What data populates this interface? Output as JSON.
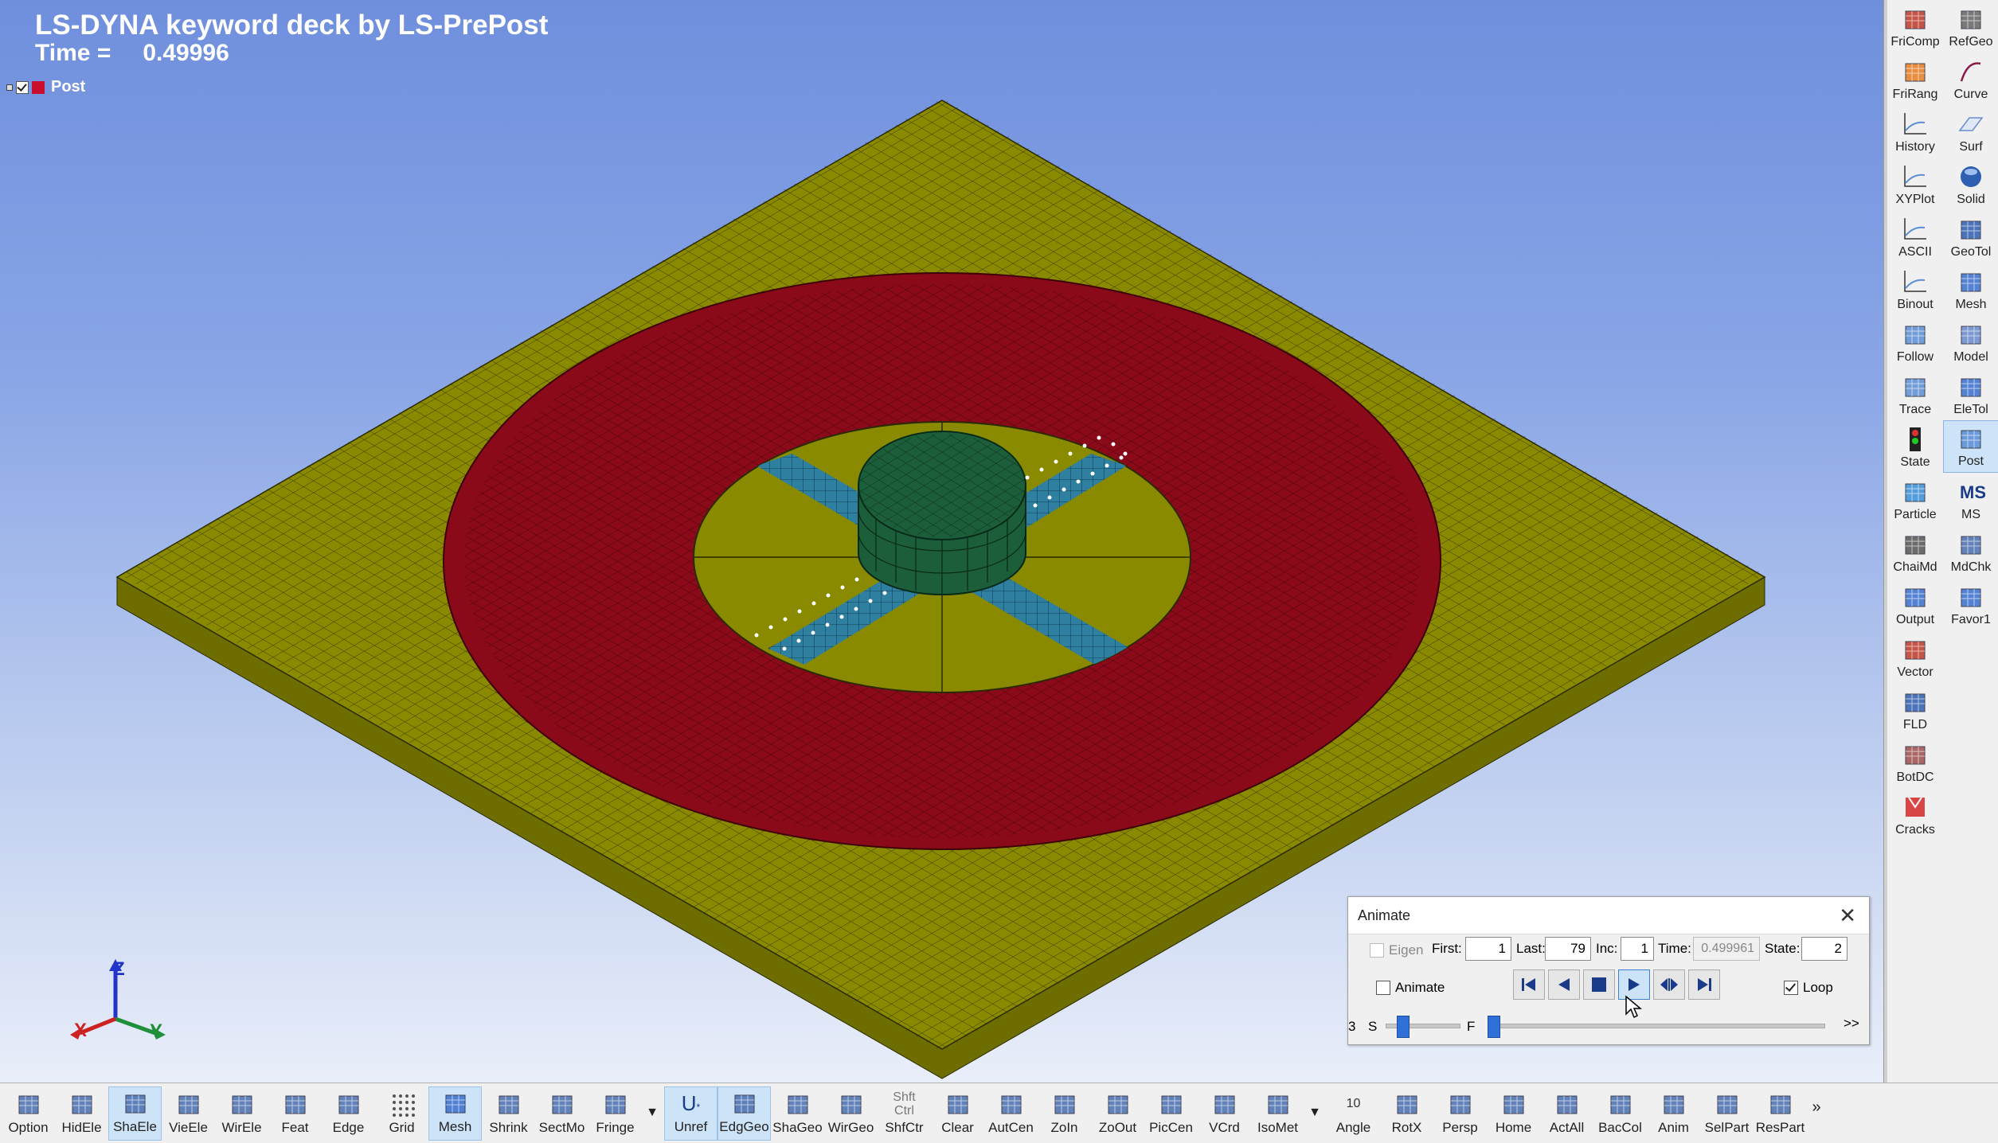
{
  "viewport": {
    "title": "LS-DYNA keyword deck by LS-PrePost",
    "time_label": "Time =",
    "time_value": "0.49996",
    "part_label": "Post",
    "axis": {
      "x": "X",
      "y": "Y",
      "z": "Z"
    }
  },
  "colors": {
    "plate": "#8a8a00",
    "ring": "#8b0a1a",
    "cylinder": "#1d5e3a",
    "strip": "#2f7fa0",
    "bg_top": "#6f8fdd",
    "bg_bottom": "#e9eef9",
    "accent": "#2e6fd8"
  },
  "right_panel": {
    "left": [
      {
        "label": "FriComp",
        "icon": "fricomp-icon"
      },
      {
        "label": "FriRang",
        "icon": "frirang-icon"
      },
      {
        "label": "History",
        "icon": "history-icon"
      },
      {
        "label": "XYPlot",
        "icon": "xyplot-icon"
      },
      {
        "label": "ASCII",
        "icon": "ascii-icon"
      },
      {
        "label": "Binout",
        "icon": "binout-icon"
      },
      {
        "label": "Follow",
        "icon": "follow-icon"
      },
      {
        "label": "Trace",
        "icon": "trace-icon"
      },
      {
        "label": "State",
        "icon": "state-icon"
      },
      {
        "label": "Particle",
        "icon": "particle-icon"
      },
      {
        "label": "ChaiMd",
        "icon": "chaimd-icon"
      },
      {
        "label": "Output",
        "icon": "output-icon"
      },
      {
        "label": "Vector",
        "icon": "vector-icon"
      },
      {
        "label": "FLD",
        "icon": "fld-icon"
      },
      {
        "label": "BotDC",
        "icon": "botdc-icon"
      },
      {
        "label": "Cracks",
        "icon": "cracks-icon"
      }
    ],
    "right": [
      {
        "label": "RefGeo",
        "icon": "refgeo-icon"
      },
      {
        "label": "Curve",
        "icon": "curve-icon"
      },
      {
        "label": "Surf",
        "icon": "surf-icon"
      },
      {
        "label": "Solid",
        "icon": "solid-icon"
      },
      {
        "label": "GeoTol",
        "icon": "geotol-icon"
      },
      {
        "label": "Mesh",
        "icon": "mesh-icon"
      },
      {
        "label": "Model",
        "icon": "model-icon"
      },
      {
        "label": "EleTol",
        "icon": "eletol-icon"
      },
      {
        "label": "Post",
        "icon": "post-icon"
      },
      {
        "label": "MS",
        "icon": "ms-icon"
      },
      {
        "label": "MdChk",
        "icon": "mdchk-icon"
      },
      {
        "label": "Favor1",
        "icon": "favor-icon"
      }
    ]
  },
  "bottom_toolbar": [
    {
      "label": "Option",
      "icon": "option-icon"
    },
    {
      "label": "HidEle",
      "icon": "hidele-icon"
    },
    {
      "label": "ShaEle",
      "icon": "shaele-icon"
    },
    {
      "label": "VieEle",
      "icon": "vieele-icon"
    },
    {
      "label": "WirEle",
      "icon": "wirele-icon"
    },
    {
      "label": "Feat",
      "icon": "feat-icon"
    },
    {
      "label": "Edge",
      "icon": "edge-icon"
    },
    {
      "label": "Grid",
      "icon": "grid-icon"
    },
    {
      "label": "Mesh",
      "icon": "mesh-icon"
    },
    {
      "label": "Shrink",
      "icon": "shrink-icon"
    },
    {
      "label": "SectMo",
      "icon": "sectmo-icon"
    },
    {
      "label": "Fringe",
      "icon": "fringe-icon"
    },
    {
      "label": "Unref",
      "icon": "unref-icon"
    },
    {
      "label": "EdgGeo",
      "icon": "edggeo-icon"
    },
    {
      "label": "ShaGeo",
      "icon": "shageo-icon"
    },
    {
      "label": "WirGeo",
      "icon": "wirgeo-icon"
    },
    {
      "label": "ShfCtr",
      "icon": "shfctr-icon",
      "top1": "Shft",
      "top2": "Ctrl"
    },
    {
      "label": "Clear",
      "icon": "clear-icon"
    },
    {
      "label": "AutCen",
      "icon": "autcen-icon"
    },
    {
      "label": "ZoIn",
      "icon": "zoin-icon"
    },
    {
      "label": "ZoOut",
      "icon": "zoout-icon"
    },
    {
      "label": "PicCen",
      "icon": "piccen-icon"
    },
    {
      "label": "VCrd",
      "icon": "vcrd-icon"
    },
    {
      "label": "IsoMet",
      "icon": "isomet-icon"
    },
    {
      "label": "Angle",
      "icon": "angle-icon",
      "top": "10"
    },
    {
      "label": "RotX",
      "icon": "rotx-icon"
    },
    {
      "label": "Persp",
      "icon": "persp-icon"
    },
    {
      "label": "Home",
      "icon": "home-icon"
    },
    {
      "label": "ActAll",
      "icon": "actall-icon"
    },
    {
      "label": "BacCol",
      "icon": "baccol-icon"
    },
    {
      "label": "Anim",
      "icon": "anim-icon"
    },
    {
      "label": "SelPart",
      "icon": "selpart-icon"
    },
    {
      "label": "ResPart",
      "icon": "respart-icon"
    }
  ],
  "more_arrow": "»",
  "animate_dialog": {
    "title": "Animate",
    "eigen_label": "Eigen",
    "first_label": "First:",
    "first_value": "1",
    "last_label": "Last:",
    "last_value": "79",
    "inc_label": "Inc:",
    "inc_value": "1",
    "time_label": "Time:",
    "time_value": "0.499961",
    "state_label": "State:",
    "state_value": "2",
    "animate_label": "Animate",
    "loop_label": "Loop",
    "loop_checked": true,
    "speed_prefix": "3",
    "speed_label": "S",
    "frame_label": "F",
    "expand": ">>",
    "speed_level": 0.15,
    "frame_level": 0.0
  }
}
